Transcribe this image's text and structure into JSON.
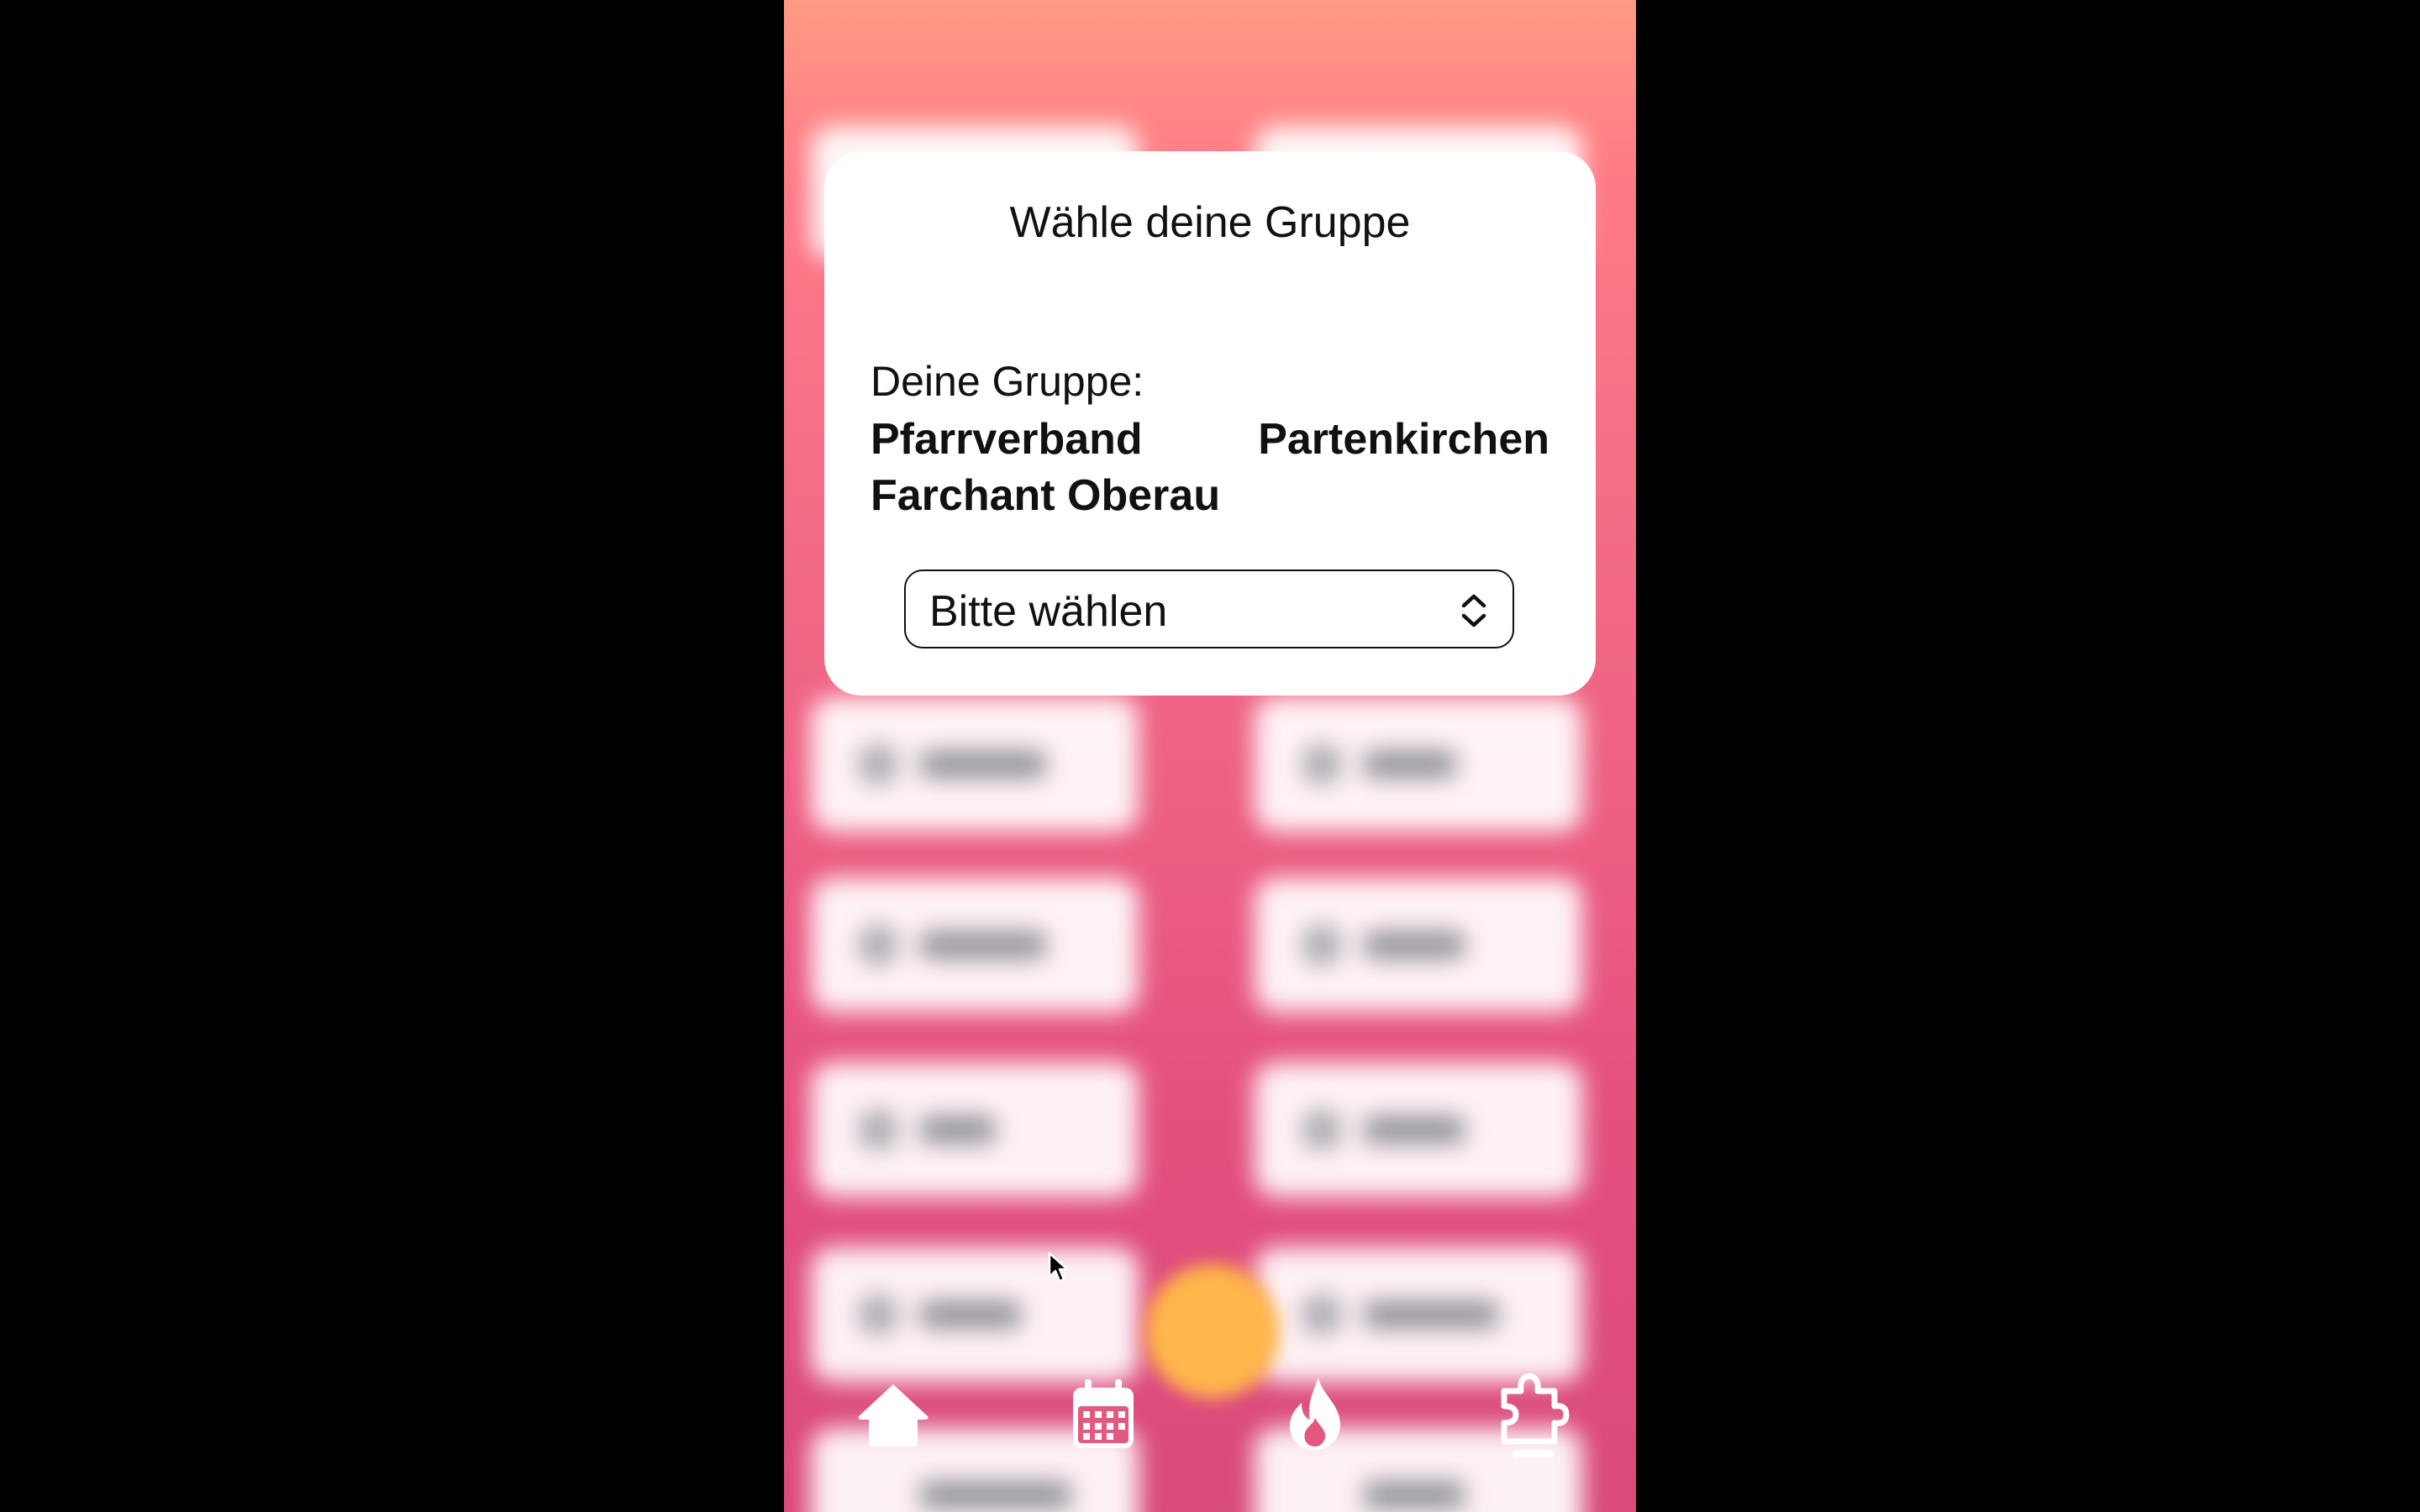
{
  "dialog": {
    "title": "Wähle deine Gruppe",
    "group_label": "Deine Gruppe:",
    "group_name": "Pfarrverband Partenkirchen Farchant Oberau",
    "select": {
      "value": "Bitte wählen",
      "icon": "chevron-up-down-icon"
    }
  },
  "nav": {
    "items": [
      {
        "icon": "home-icon"
      },
      {
        "icon": "calendar-icon"
      },
      {
        "icon": "flame-icon"
      },
      {
        "icon": "puzzle-settings-icon"
      }
    ]
  },
  "colors": {
    "background_top": "#ff9a84",
    "background_bottom": "#d94a7d",
    "fab": "#ffb64a"
  }
}
